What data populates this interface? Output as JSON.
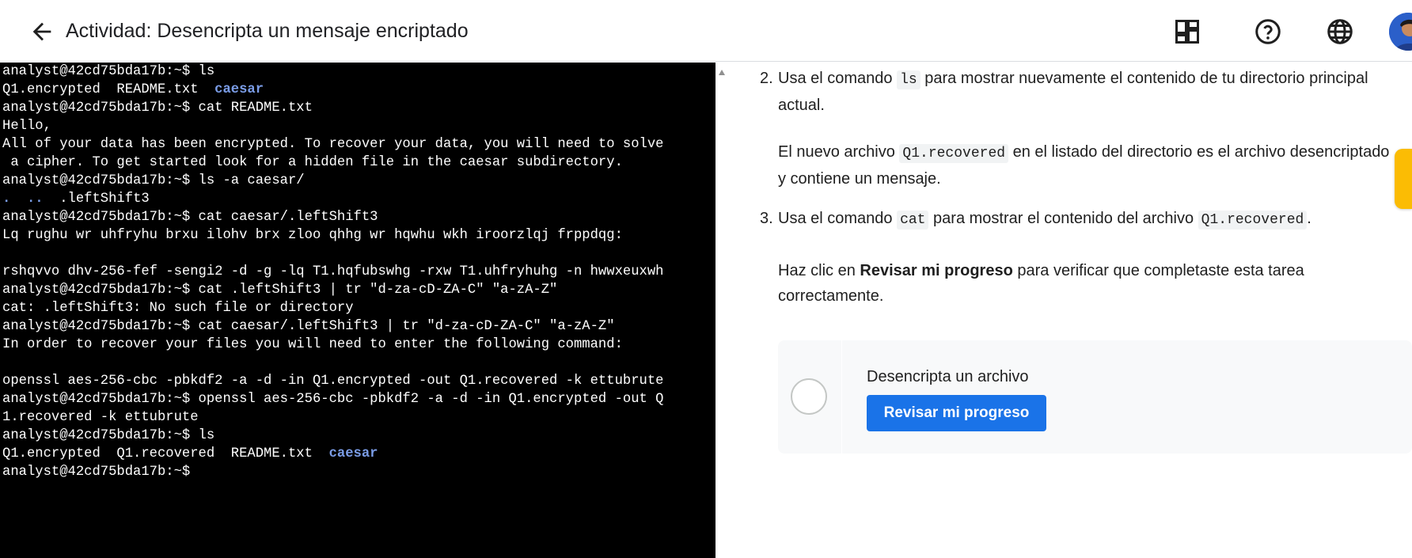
{
  "header": {
    "title": "Actividad: Desencripta un mensaje encriptado",
    "icons": [
      "back-arrow-icon",
      "dashboard-icon",
      "help-icon",
      "language-icon",
      "avatar"
    ]
  },
  "terminal": {
    "lines": [
      [
        "analyst@42cd75bda17b:~$ ls"
      ],
      [
        "Q1.encrypted  README.txt  ",
        {
          "dir": "caesar"
        }
      ],
      [
        "analyst@42cd75bda17b:~$ cat README.txt"
      ],
      [
        "Hello,"
      ],
      [
        "All of your data has been encrypted. To recover your data, you will need to solve"
      ],
      [
        " a cipher. To get started look for a hidden file in the caesar subdirectory."
      ],
      [
        "analyst@42cd75bda17b:~$ ls -a caesar/"
      ],
      [
        {
          "dir": "."
        },
        "  ",
        {
          "dir": ".."
        },
        "  .leftShift3"
      ],
      [
        "analyst@42cd75bda17b:~$ cat caesar/.leftShift3"
      ],
      [
        "Lq rughu wr uhfryhu brxu ilohv brx zloo qhhg wr hqwhu wkh iroorzlqj frppdqg:"
      ],
      [
        ""
      ],
      [
        "rshqvvo dhv-256-fef -sengi2 -d -g -lq T1.hqfubswhg -rxw T1.uhfryhuhg -n hwwxeuxwh"
      ],
      [
        "analyst@42cd75bda17b:~$ cat .leftShift3 | tr \"d-za-cD-ZA-C\" \"a-zA-Z\""
      ],
      [
        "cat: .leftShift3: No such file or directory"
      ],
      [
        "analyst@42cd75bda17b:~$ cat caesar/.leftShift3 | tr \"d-za-cD-ZA-C\" \"a-zA-Z\""
      ],
      [
        "In order to recover your files you will need to enter the following command:"
      ],
      [
        ""
      ],
      [
        "openssl aes-256-cbc -pbkdf2 -a -d -in Q1.encrypted -out Q1.recovered -k ettubrute"
      ],
      [
        "analyst@42cd75bda17b:~$ openssl aes-256-cbc -pbkdf2 -a -d -in Q1.encrypted -out Q"
      ],
      [
        "1.recovered -k ettubrute"
      ],
      [
        "analyst@42cd75bda17b:~$ ls"
      ],
      [
        "Q1.encrypted  Q1.recovered  README.txt  ",
        {
          "dir": "caesar"
        }
      ],
      [
        "analyst@42cd75bda17b:~$ "
      ]
    ]
  },
  "instructions": {
    "step2": {
      "num": "2.",
      "before": "Usa el comando ",
      "code": "ls",
      "after": " para mostrar nuevamente el contenido de tu directorio principal",
      "line2": "actual."
    },
    "para1": {
      "before": "El nuevo archivo ",
      "code": "Q1.recovered",
      "after": " en el listado del directorio es el archivo desencriptado",
      "line2": "y contiene un mensaje."
    },
    "step3": {
      "num": "3.",
      "before": "Usa el comando ",
      "code": "cat",
      "middle": " para mostrar el contenido del archivo ",
      "code2": "Q1.recovered",
      "after": "."
    },
    "para2": {
      "before": "Haz clic en ",
      "bold": "Revisar mi progreso",
      "after": " para verificar que completaste esta tarea",
      "line2": "correctamente."
    }
  },
  "card": {
    "title": "Desencripta un archivo",
    "button": "Revisar mi progreso"
  },
  "colors": {
    "terminal_bg": "#000000",
    "terminal_dir": "#7a9ce6",
    "button_blue": "#1a73e8",
    "side_tab": "#fbbc04"
  }
}
